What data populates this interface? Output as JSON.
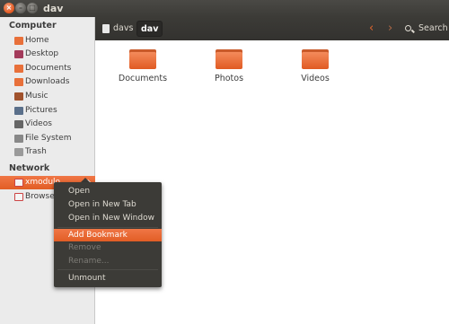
{
  "window": {
    "title": "dav",
    "close_glyph": "×",
    "min_glyph": "–",
    "max_glyph": "□"
  },
  "sidebar": {
    "computer_title": "Computer",
    "items": [
      {
        "label": "Home",
        "icon": "home-icon",
        "color": "#e8703a"
      },
      {
        "label": "Desktop",
        "icon": "desktop-icon",
        "color": "#a33b5b"
      },
      {
        "label": "Documents",
        "icon": "documents-icon",
        "color": "#e8703a"
      },
      {
        "label": "Downloads",
        "icon": "downloads-icon",
        "color": "#e8703a"
      },
      {
        "label": "Music",
        "icon": "music-icon",
        "color": "#a0522d"
      },
      {
        "label": "Pictures",
        "icon": "pictures-icon",
        "color": "#5a6f8a"
      },
      {
        "label": "Videos",
        "icon": "videos-icon",
        "color": "#666666"
      },
      {
        "label": "File System",
        "icon": "filesystem-icon",
        "color": "#888888"
      },
      {
        "label": "Trash",
        "icon": "trash-icon",
        "color": "#9a9a9a"
      }
    ],
    "network_title": "Network",
    "network_items": [
      {
        "label": "xmodulo",
        "icon": "network-share-icon",
        "active": true
      },
      {
        "label": "Browse",
        "icon": "browse-network-icon",
        "active": false
      }
    ]
  },
  "toolbar": {
    "breadcrumbs": [
      "davs",
      "dav"
    ],
    "back_glyph": "‹",
    "forward_glyph": "›",
    "search_label": "Search"
  },
  "content": {
    "folders": [
      "Documents",
      "Photos",
      "Videos"
    ]
  },
  "context_menu": {
    "items": [
      "Open",
      "Open in New Tab",
      "Open in New Window",
      "Add Bookmark",
      "Remove",
      "Rename...",
      "Unmount"
    ],
    "highlighted": "Add Bookmark",
    "disabled": [
      "Remove",
      "Rename..."
    ]
  },
  "colors": {
    "accent": "#e25d25",
    "toolbar": "#3c3b37",
    "sidebar": "#ebebeb"
  }
}
